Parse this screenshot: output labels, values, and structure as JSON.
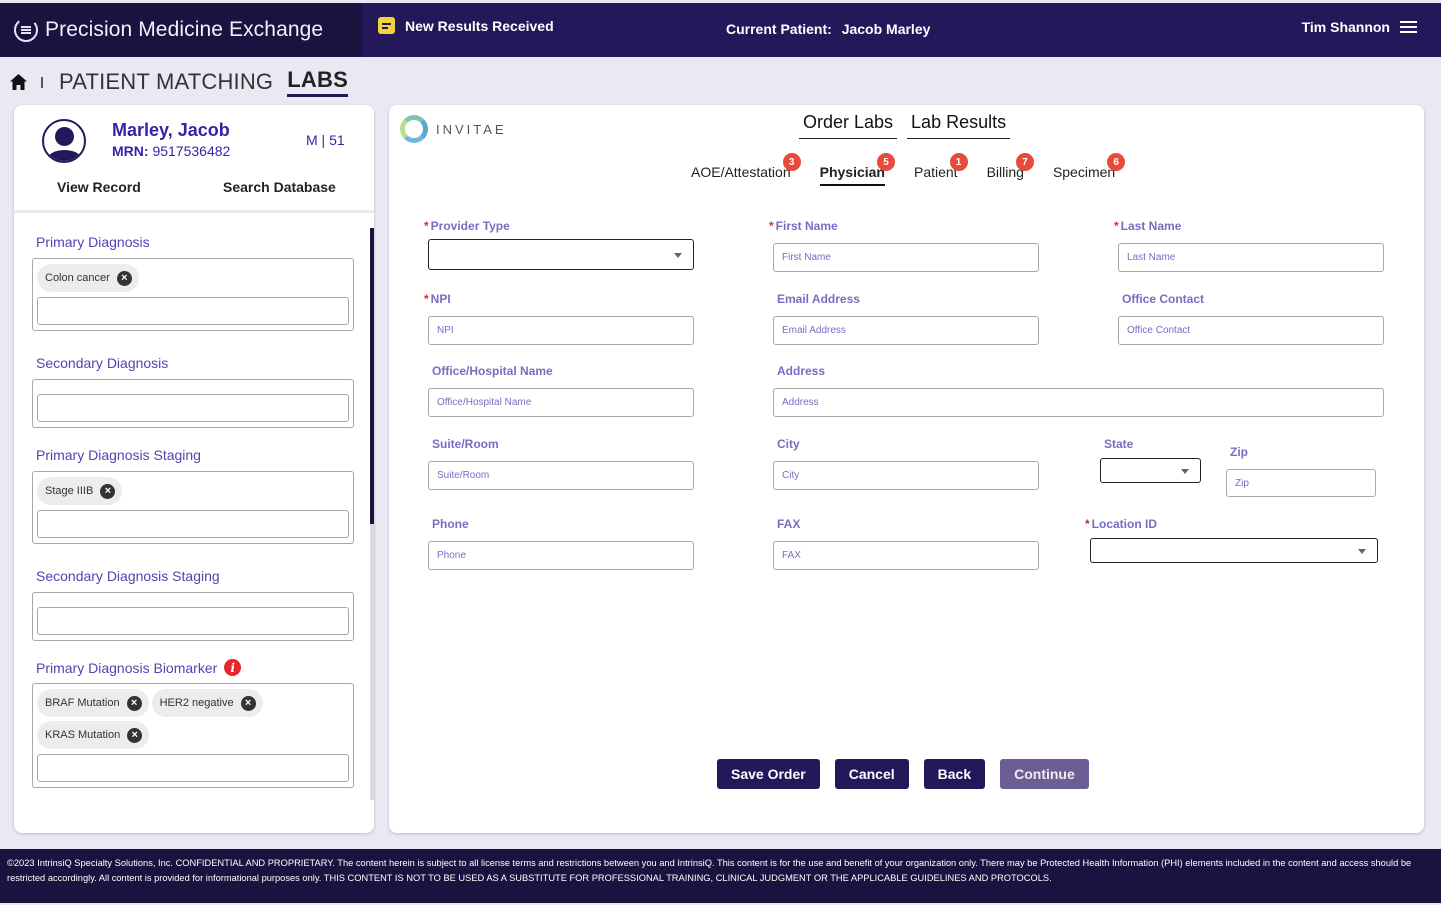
{
  "header": {
    "app_name": "Precision Medicine Exchange",
    "notification": "New Results Received",
    "current_patient_label": "Current Patient:",
    "current_patient_name": "Jacob Marley",
    "user_name": "Tim Shannon"
  },
  "breadcrumb": {
    "items": [
      "PATIENT MATCHING",
      "LABS"
    ]
  },
  "patient": {
    "name": "Marley, Jacob",
    "mrn_label": "MRN:",
    "mrn": "9517536482",
    "sex_age": "M | 51",
    "view_record": "View Record",
    "search_database": "Search Database"
  },
  "diagnosis": {
    "primary": {
      "title": "Primary Diagnosis",
      "chips": [
        "Colon cancer"
      ]
    },
    "secondary": {
      "title": "Secondary Diagnosis",
      "chips": []
    },
    "primary_staging": {
      "title": "Primary Diagnosis Staging",
      "chips": [
        "Stage IIIB"
      ]
    },
    "secondary_staging": {
      "title": "Secondary Diagnosis Staging",
      "chips": []
    },
    "biomarker": {
      "title": "Primary Diagnosis Biomarker",
      "chips": [
        "BRAF Mutation",
        "HER2 negative",
        "KRAS Mutation"
      ]
    }
  },
  "lab": {
    "vendor": "INVITAE",
    "main_tabs": [
      "Order Labs",
      "Lab Results"
    ],
    "sub_tabs": [
      {
        "label": "AOE/Attestation",
        "badge": "3"
      },
      {
        "label": "Physician",
        "badge": "5",
        "active": true
      },
      {
        "label": "Patient",
        "badge": "1"
      },
      {
        "label": "Billing",
        "badge": "7"
      },
      {
        "label": "Specimen",
        "badge": "6"
      }
    ]
  },
  "form": {
    "provider_type": {
      "label": "Provider Type",
      "required": true,
      "value": ""
    },
    "first_name": {
      "label": "First Name",
      "required": true,
      "placeholder": "First Name"
    },
    "last_name": {
      "label": "Last Name",
      "required": true,
      "placeholder": "Last Name"
    },
    "npi": {
      "label": "NPI",
      "required": true,
      "placeholder": "NPI"
    },
    "email": {
      "label": "Email Address",
      "placeholder": "Email Address"
    },
    "office_contact": {
      "label": "Office Contact",
      "placeholder": "Office Contact"
    },
    "office_name": {
      "label": "Office/Hospital Name",
      "placeholder": "Office/Hospital Name"
    },
    "address": {
      "label": "Address",
      "placeholder": "Address"
    },
    "suite": {
      "label": "Suite/Room",
      "placeholder": "Suite/Room"
    },
    "city": {
      "label": "City",
      "placeholder": "City"
    },
    "state": {
      "label": "State",
      "value": ""
    },
    "zip": {
      "label": "Zip",
      "placeholder": "Zip"
    },
    "phone": {
      "label": "Phone",
      "placeholder": "Phone"
    },
    "fax": {
      "label": "FAX",
      "placeholder": "FAX"
    },
    "location_id": {
      "label": "Location ID",
      "required": true,
      "value": ""
    },
    "required_mark": "*"
  },
  "actions": {
    "save": "Save Order",
    "cancel": "Cancel",
    "back": "Back",
    "continue": "Continue"
  },
  "footer": {
    "text": "©2023 IntrinsiQ Specialty Solutions, Inc. CONFIDENTIAL AND PROPRIETARY. The content herein is subject to all license terms and restrictions between you and IntrinsiQ. This content is for the use and benefit of your organization only. There may be Protected Health Information (PHI) elements included in the content and access should be restricted accordingly. All content is provided for informational purposes only. THIS CONTENT IS NOT TO BE USED AS A SUBSTITUTE FOR PROFESSIONAL TRAINING, CLINICAL JUDGMENT OR THE APPLICABLE GUIDELINES AND PROTOCOLS."
  },
  "colors": {
    "brand_dark": "#1b1240",
    "brand": "#24185a",
    "accent_purple": "#5a3fb0",
    "label_purple": "#7a6cc0",
    "badge_red": "#e84a3c",
    "notice_yellow": "#f5d33a"
  }
}
